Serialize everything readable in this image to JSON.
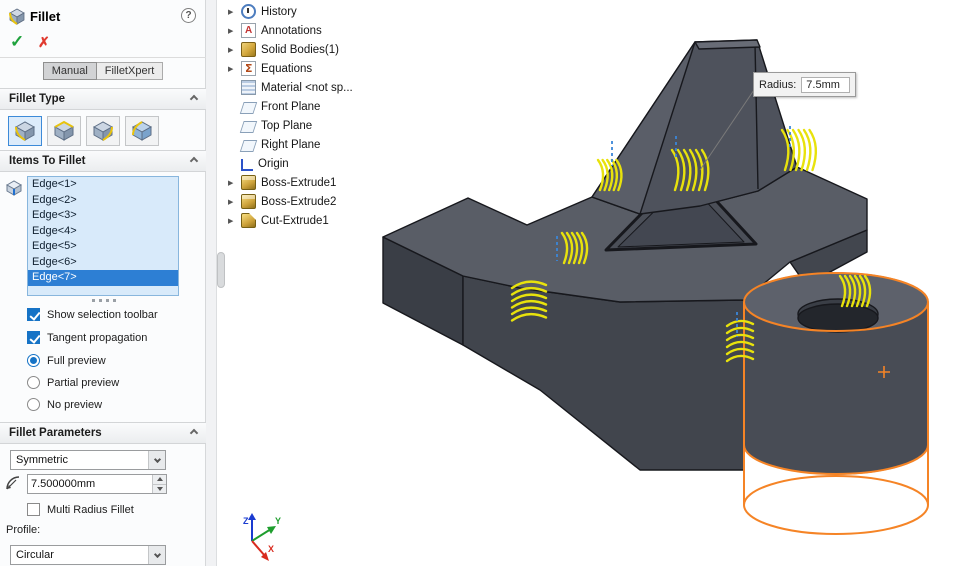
{
  "panel": {
    "title": "Fillet",
    "help_icon": "?",
    "ok_icon": "✓",
    "cancel_icon": "✗",
    "tabs": [
      {
        "label": "Manual",
        "active": true
      },
      {
        "label": "FilletXpert",
        "active": false
      }
    ],
    "fillet_type": {
      "label": "Fillet Type"
    },
    "items_to_fillet": {
      "label": "Items To Fillet",
      "edges": [
        "Edge<1>",
        "Edge<2>",
        "Edge<3>",
        "Edge<4>",
        "Edge<5>",
        "Edge<6>",
        "Edge<7>"
      ],
      "selected_edge": "Edge<7>",
      "checkboxes": [
        {
          "label": "Show selection toolbar",
          "checked": true
        },
        {
          "label": "Tangent propagation",
          "checked": true
        }
      ],
      "previews": [
        {
          "label": "Full preview",
          "selected": true
        },
        {
          "label": "Partial preview",
          "selected": false
        },
        {
          "label": "No preview",
          "selected": false
        }
      ]
    },
    "fillet_parameters": {
      "label": "Fillet Parameters",
      "symmetry_value": "Symmetric",
      "radius_value": "7.500000mm",
      "multi_radius_label": "Multi Radius Fillet",
      "multi_radius_checked": false,
      "profile_label": "Profile:",
      "profile_value": "Circular"
    }
  },
  "feature_tree": {
    "items": [
      {
        "label": "History",
        "icon": "history-icon",
        "arrow": true
      },
      {
        "label": "Annotations",
        "icon": "annotations-icon",
        "arrow": true
      },
      {
        "label": "Solid Bodies(1)",
        "icon": "solid-bodies-icon",
        "arrow": true
      },
      {
        "label": "Equations",
        "icon": "equations-icon",
        "arrow": true
      },
      {
        "label": "Material <not sp...",
        "icon": "material-icon",
        "arrow": false
      },
      {
        "label": "Front Plane",
        "icon": "plane-icon",
        "arrow": false
      },
      {
        "label": "Top Plane",
        "icon": "plane-icon",
        "arrow": false
      },
      {
        "label": "Right Plane",
        "icon": "plane-icon",
        "arrow": false
      },
      {
        "label": "Origin",
        "icon": "origin-icon",
        "arrow": false
      },
      {
        "label": "Boss-Extrude1",
        "icon": "boss-extrude-icon",
        "arrow": true
      },
      {
        "label": "Boss-Extrude2",
        "icon": "boss-extrude-icon",
        "arrow": true
      },
      {
        "label": "Cut-Extrude1",
        "icon": "cut-extrude-icon",
        "arrow": true
      }
    ]
  },
  "viewport": {
    "callout": {
      "label": "Radius:",
      "value": "7.5mm"
    },
    "triad": {
      "x": "X",
      "y": "Y",
      "z": "Z"
    },
    "colors": {
      "part_gray": "#595d66",
      "fillet_preview_yellow": "#e8e20c",
      "body_preview_orange": "#f58426",
      "selection_blue": "#2d7fd4"
    }
  }
}
